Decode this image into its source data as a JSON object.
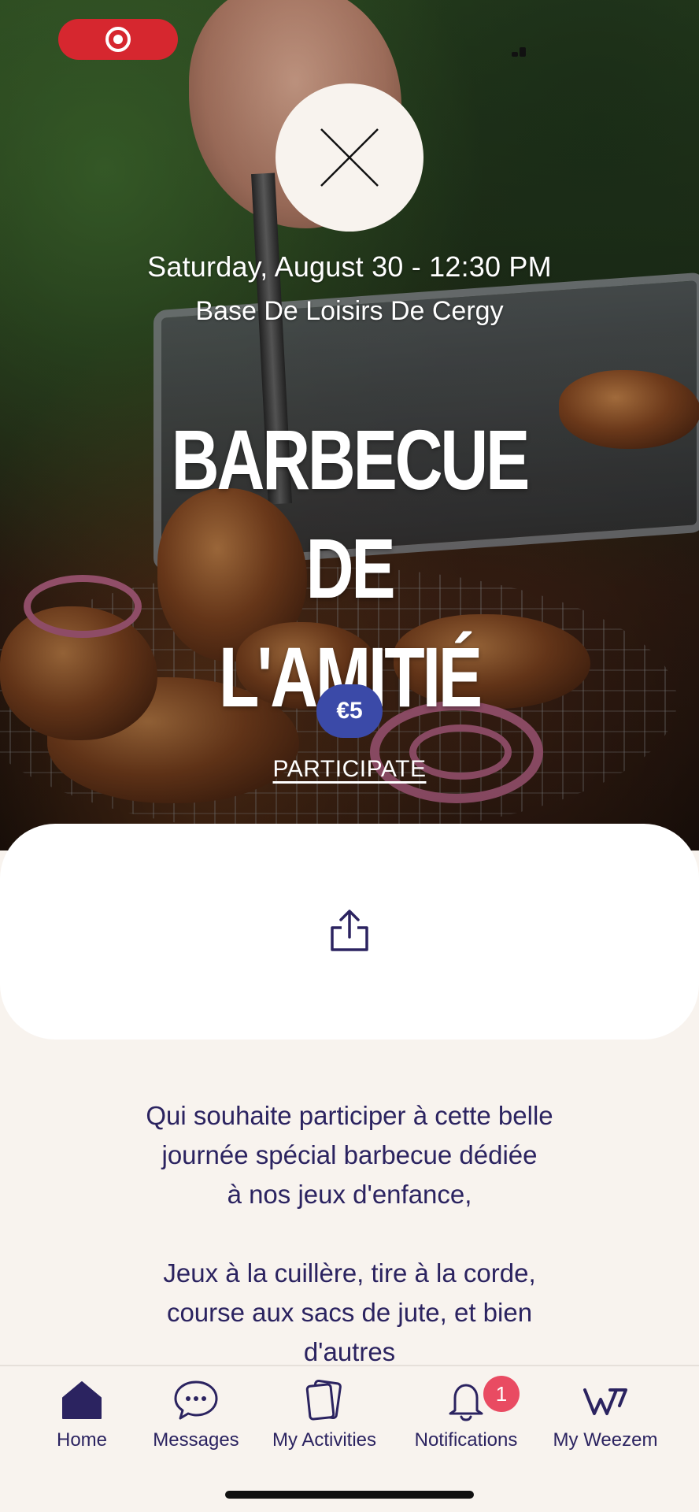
{
  "event": {
    "date": "Saturday, August 30 - 12:30 PM",
    "location": "Base De Loisirs De Cergy",
    "title_line1": "BARBECUE DE",
    "title_line2": "L'AMITIÉ",
    "price": "€5",
    "participate_label": "PARTICIPATE"
  },
  "description": {
    "para1_line1": "Qui souhaite participer à cette belle",
    "para1_line2": "journée spécial barbecue dédiée",
    "para1_line3": "à nos jeux d'enfance,",
    "para2_line1": "Jeux à la cuillère, tire à la corde,",
    "para2_line2": "course aux sacs de jute, et bien",
    "para2_line3": "d'autres"
  },
  "tab_bar": {
    "tabs": [
      {
        "label": "Home",
        "icon": "home-icon",
        "active": true
      },
      {
        "label": "Messages",
        "icon": "chat-bubble-icon"
      },
      {
        "label": "My Activities",
        "icon": "cards-icon"
      },
      {
        "label": "Notifications",
        "icon": "bell-icon",
        "badge": "1"
      },
      {
        "label": "My Weezem",
        "icon": "weezem-logo-icon"
      }
    ]
  },
  "colors": {
    "accent": "#2b2360",
    "price_badge": "#3b4aa8",
    "notification_badge": "#e94b62",
    "record_pill": "#d6272f",
    "background": "#f8f3ee"
  }
}
